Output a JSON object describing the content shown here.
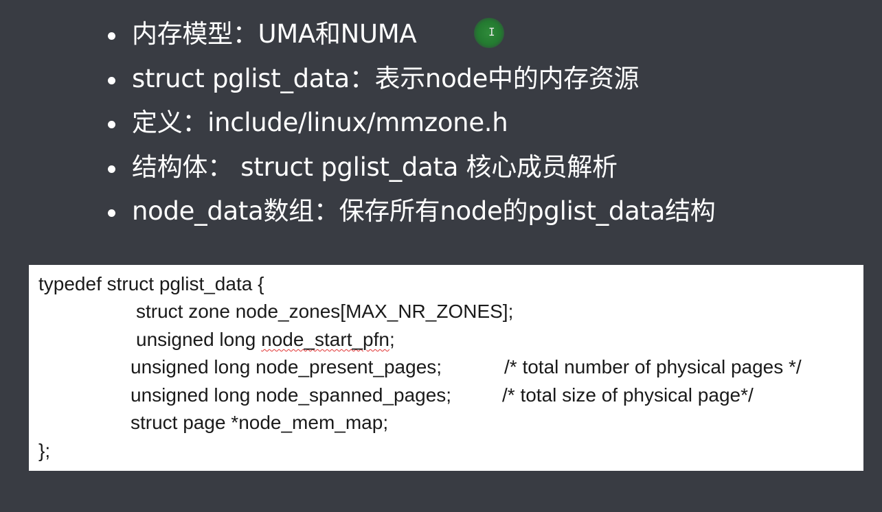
{
  "bullets": [
    {
      "text": "内存模型：UMA和NUMA"
    },
    {
      "text": "struct pglist_data：表示node中的内存资源"
    },
    {
      "text": "定义：include/linux/mmzone.h"
    },
    {
      "text": "结构体： struct pglist_data 核心成员解析"
    },
    {
      "text": "node_data数组：保存所有node的pglist_data结构"
    }
  ],
  "cursor": {
    "icon": "text-cursor-icon",
    "glyph": "I"
  },
  "code": {
    "line_1": "typedef struct pglist_data {",
    "line_2": "struct zone node_zones[MAX_NR_ZONES];",
    "line_3_prefix": "unsigned long ",
    "line_3_squiggle": "node_start_pfn",
    "line_3_suffix": ";",
    "line_4": "unsigned long node_present_pages;",
    "line_4_comment": "/* total number of physical pages */",
    "line_5": "unsigned long node_spanned_pages;",
    "line_5_comment": "/* total size of physical page*/",
    "line_6": "struct page *node_mem_map;",
    "line_7": "};"
  },
  "colors": {
    "background": "#393c43",
    "text": "#ffffff",
    "code_background": "#ffffff",
    "code_text": "#1a1a1a",
    "cursor_highlight": "#237a30",
    "spellcheck": "#e03030"
  }
}
